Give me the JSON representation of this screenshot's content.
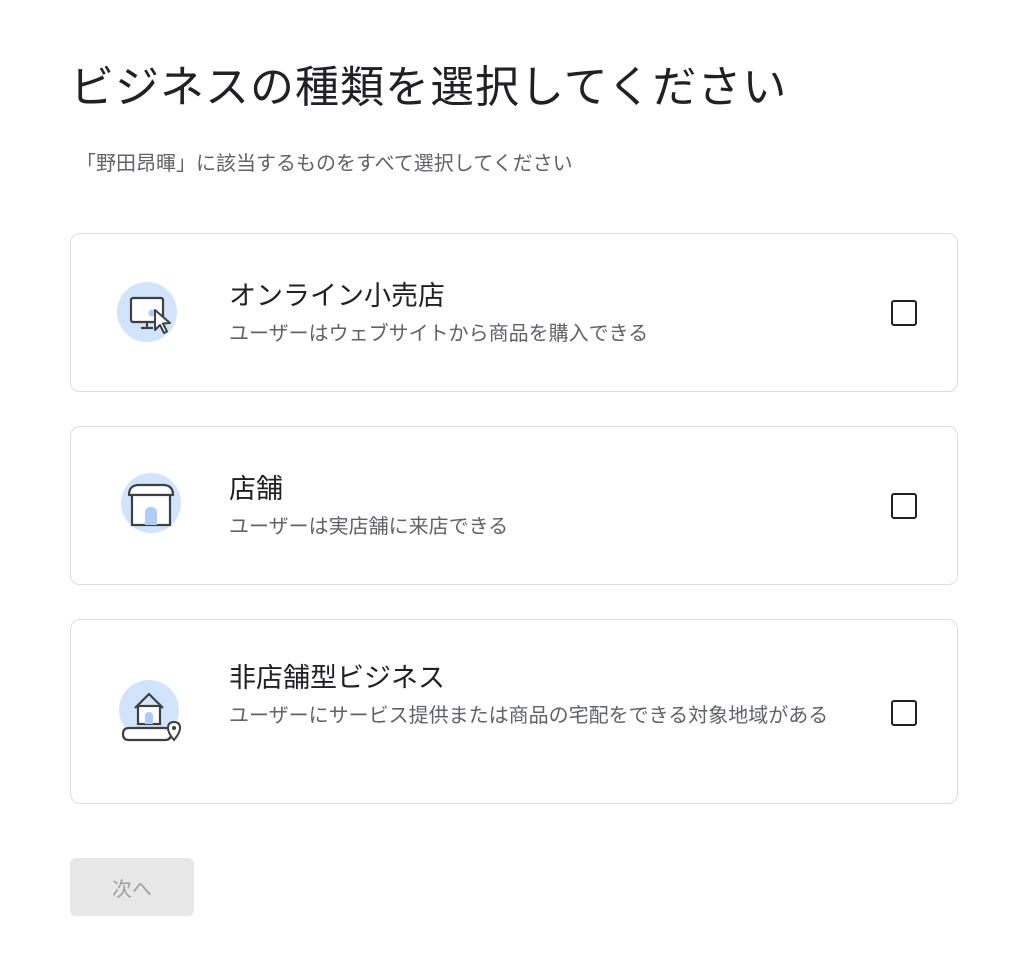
{
  "header": {
    "title": "ビジネスの種類を選択してください",
    "subtitle": "「野田昂暉」に該当するものをすべて選択してください"
  },
  "options": [
    {
      "title": "オンライン小売店",
      "description": "ユーザーはウェブサイトから商品を購入できる",
      "icon": "monitor-cursor-icon",
      "checked": false
    },
    {
      "title": "店舗",
      "description": "ユーザーは実店舗に来店できる",
      "icon": "storefront-icon",
      "checked": false
    },
    {
      "title": "非店舗型ビジネス",
      "description": "ユーザーにサービス提供または商品の宅配をできる対象地域がある",
      "icon": "house-map-pin-icon",
      "checked": false
    }
  ],
  "footer": {
    "next_label": "次へ",
    "next_enabled": false
  },
  "colors": {
    "icon_circle": "#d2e3fc",
    "icon_stroke": "#3c4043",
    "icon_accent": "#aecbfa",
    "border": "#dadce0",
    "disabled_button_bg": "#e8e8e8",
    "disabled_button_text": "#a0a0a0"
  }
}
